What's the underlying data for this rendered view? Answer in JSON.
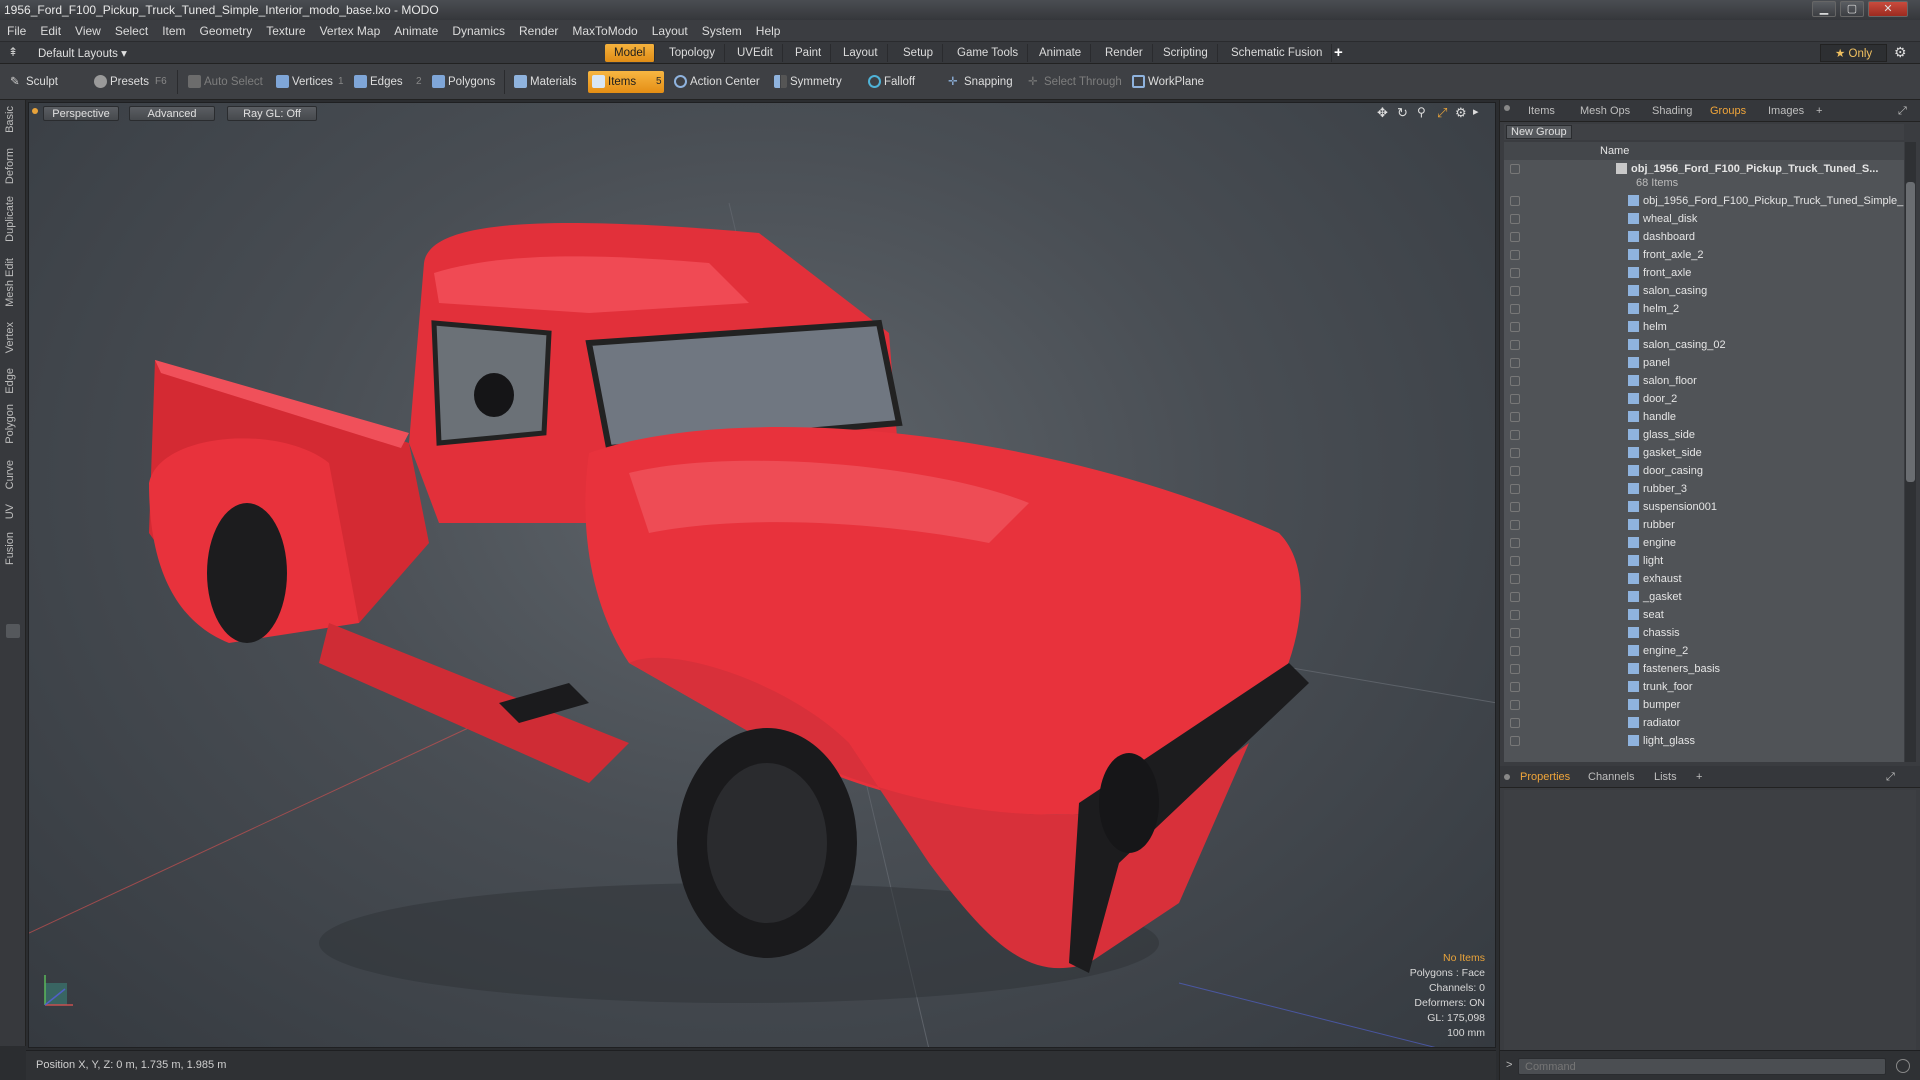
{
  "window": {
    "title": "1956_Ford_F100_Pickup_Truck_Tuned_Simple_Interior_modo_base.lxo - MODO",
    "minimize": "▁",
    "maximize": "▢",
    "close": "✕"
  },
  "menu": [
    "File",
    "Edit",
    "View",
    "Select",
    "Item",
    "Geometry",
    "Texture",
    "Vertex Map",
    "Animate",
    "Dynamics",
    "Render",
    "MaxToModo",
    "Layout",
    "System",
    "Help"
  ],
  "layoutbar": {
    "layout_dropdown": "Default Layouts ▾",
    "tabs": [
      "Model",
      "Topology",
      "UVEdit",
      "Paint",
      "Layout",
      "Setup",
      "Game Tools",
      "Animate",
      "Render",
      "Scripting",
      "Schematic Fusion"
    ],
    "active_tab": "Model",
    "add": "+",
    "only": "★ Only",
    "gear": "⚙"
  },
  "toolbar": {
    "sculpt": "Sculpt",
    "presets": "Presets",
    "presets_key": "F6",
    "auto_select": "Auto Select",
    "vertices": "Vertices",
    "vertices_count": "1",
    "edges": "Edges",
    "edges_count": "2",
    "polygons": "Polygons",
    "materials": "Materials",
    "items": "Items",
    "items_count": "5",
    "action_center": "Action Center",
    "symmetry": "Symmetry",
    "falloff": "Falloff",
    "snapping": "Snapping",
    "select_through": "Select Through",
    "workplane": "WorkPlane"
  },
  "left_tabs": [
    "Basic",
    "Deform",
    "Duplicate",
    "Mesh Edit",
    "Vertex",
    "Edge",
    "Polygon",
    "Curve",
    "UV",
    "Fusion"
  ],
  "viewport": {
    "view_mode": "Perspective",
    "shading": "Advanced",
    "raygl": "Ray GL: Off",
    "info": {
      "selection": "No Items",
      "polygons": "Polygons : Face",
      "channels": "Channels: 0",
      "deformers": "Deformers: ON",
      "gl": "GL: 175,098",
      "scale": "100 mm"
    }
  },
  "statusbar": {
    "position": "Position X, Y, Z:  0 m, 1.735 m, 1.985 m"
  },
  "right_panel": {
    "top_tabs": [
      "Items",
      "Mesh Ops",
      "Shading",
      "Groups",
      "Images"
    ],
    "active_top_tab": "Groups",
    "new_group": "New Group",
    "column_name": "Name",
    "group_name": "obj_1956_Ford_F100_Pickup_Truck_Tuned_S...",
    "group_count": "68 Items",
    "items": [
      "obj_1956_Ford_F100_Pickup_Truck_Tuned_Simple_...",
      "wheal_disk",
      "dashboard",
      "front_axle_2",
      "front_axle",
      "salon_casing",
      "helm_2",
      "helm",
      "salon_casing_02",
      "panel",
      "salon_floor",
      "door_2",
      "handle",
      "glass_side",
      "gasket_side",
      "door_casing",
      "rubber_3",
      "suspension001",
      "rubber",
      "engine",
      "light",
      "exhaust",
      "_gasket",
      "seat",
      "chassis",
      "engine_2",
      "fasteners_basis",
      "trunk_foor",
      "bumper",
      "radiator",
      "light_glass"
    ],
    "bottom_tabs": [
      "Properties",
      "Channels",
      "Lists"
    ],
    "active_bottom_tab": "Properties",
    "command_placeholder": "Command"
  },
  "colors": {
    "accent": "#f0a53a",
    "truck_body": "#e8303a",
    "viewport_bg": "#4a4f55"
  }
}
